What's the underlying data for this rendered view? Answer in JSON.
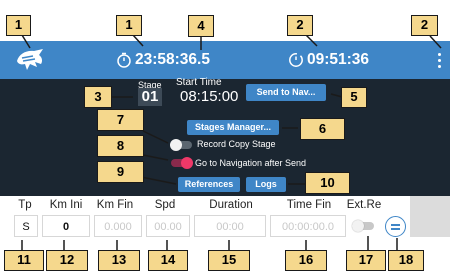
{
  "topbar": {
    "elapsed_time": "23:58:36.5",
    "clock_time": "09:51:36",
    "colors": {
      "bar": "#3f86c7",
      "panel": "#1b2631",
      "accent_toggle": "#ee3868",
      "callout": "#f5d88d"
    }
  },
  "stage": {
    "label": "Stage",
    "value": "01"
  },
  "start_time": {
    "label": "Start Time",
    "value": "08:15:00"
  },
  "buttons": {
    "send_to_nav": "Send to Nav...",
    "stages_manager": "Stages Manager...",
    "references": "References",
    "logs": "Logs"
  },
  "toggles": {
    "record_copy_stage": {
      "label": "Record Copy Stage",
      "on": false
    },
    "go_to_navigation": {
      "label": "Go to Navigation after Send",
      "on": true
    }
  },
  "table": {
    "headers": [
      "Tp",
      "Km Ini",
      "Km Fin",
      "Spd",
      "Duration",
      "Time Fin",
      "Ext.Re"
    ],
    "row": {
      "tp": "S",
      "km_ini": "0",
      "km_fin": "0.000",
      "spd": "00.00",
      "duration": "00:00",
      "time_fin": "00:00:00.0",
      "ext_re_on": false
    }
  },
  "callouts": [
    "1",
    "1",
    "2",
    "2",
    "3",
    "4",
    "5",
    "6",
    "7",
    "8",
    "9",
    "10",
    "11",
    "12",
    "13",
    "14",
    "15",
    "16",
    "17",
    "18"
  ],
  "icons": [
    "app-logo-icon",
    "stopwatch-icon",
    "clock-icon",
    "kebab-menu-icon",
    "row-menu-icon"
  ]
}
